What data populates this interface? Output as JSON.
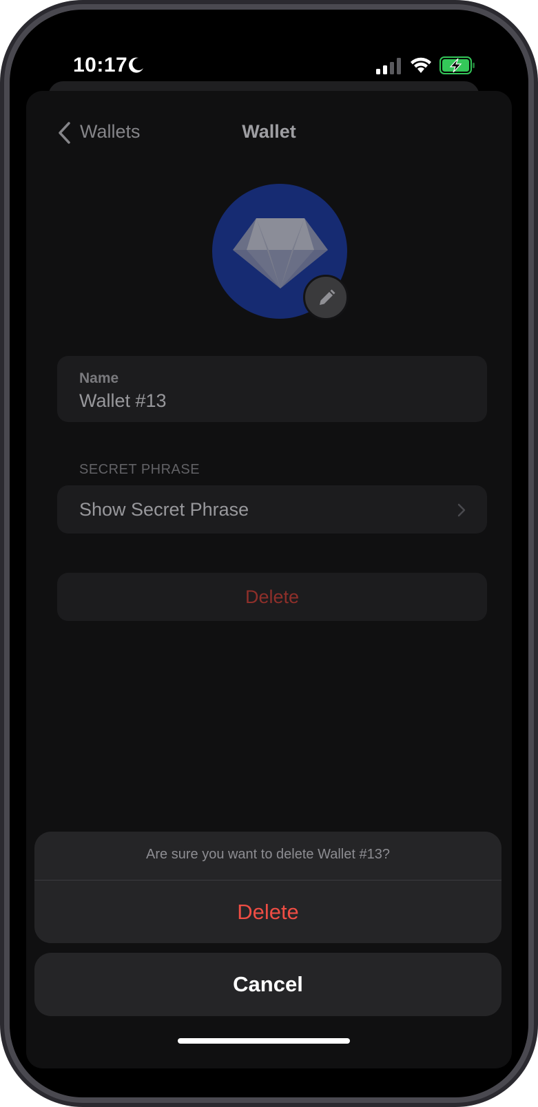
{
  "status_bar": {
    "time": "10:17",
    "icons": [
      "moon-icon",
      "signal-icon",
      "wifi-icon",
      "battery-charging-icon"
    ],
    "battery_color": "#34c759"
  },
  "nav": {
    "back_label": "Wallets",
    "title": "Wallet"
  },
  "avatar": {
    "icon": "diamond-icon",
    "background": "#162b72",
    "edit_icon": "pencil-icon"
  },
  "name_field": {
    "label": "Name",
    "value": "Wallet #13"
  },
  "secret_section": {
    "header": "SECRET PHRASE",
    "row_label": "Show Secret Phrase"
  },
  "delete_row": {
    "label": "Delete",
    "color": "#8e2f2a"
  },
  "action_sheet": {
    "message": "Are sure you want to delete Wallet #13?",
    "destructive_label": "Delete",
    "destructive_color": "#ee4d44",
    "cancel_label": "Cancel"
  }
}
